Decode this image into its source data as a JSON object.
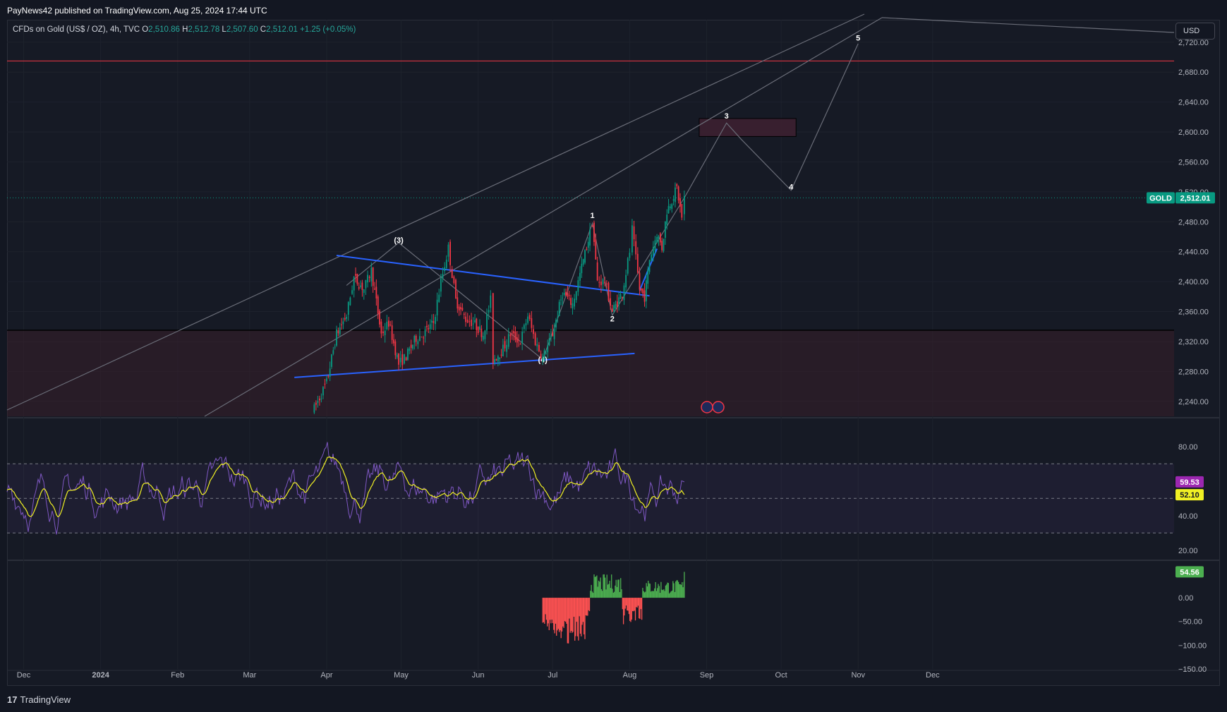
{
  "header": {
    "published": "PayNews42 published on TradingView.com, Aug 25, 2024 17:44 UTC"
  },
  "legend": {
    "symbol": "CFDs on Gold (US$ / OZ), 4h, TVC",
    "o_label": "O",
    "o_value": "2,510.86",
    "h_label": "H",
    "h_value": "2,512.78",
    "l_label": "L",
    "l_value": "2,507.60",
    "c_label": "C",
    "c_value": "2,512.01",
    "change": "+1.25 (+0.05%)"
  },
  "currency_button": "USD",
  "price_tag": {
    "symbol": "GOLD",
    "value": "2,512.01",
    "color": "#089981"
  },
  "rsi_tags": {
    "rsi": "59.53",
    "rsi_color": "#9c27b0",
    "ma": "52.10",
    "ma_color": "#f0f024"
  },
  "osc_tag": {
    "value": "54.56",
    "color": "#4caf50"
  },
  "footer": {
    "logo": "TradingView",
    "logo_mark": "17"
  },
  "colors": {
    "bull": "#089981",
    "bear": "#f23645",
    "trend": "#2962ff",
    "rsi": "#7e57c2",
    "rsi_ma": "#f0f024",
    "hist_pos": "#4caf50",
    "hist_neg": "#ff5252",
    "zone": "#3d1f2a",
    "target_zone": "#3a2030"
  },
  "chart_data": {
    "type": "candlestick",
    "timeframe": "4h",
    "x_ticks": [
      "Dec",
      "2024",
      "Feb",
      "Mar",
      "Apr",
      "May",
      "Jun",
      "Jul",
      "Aug",
      "Sep",
      "Oct",
      "Nov",
      "Dec"
    ],
    "y_ticks": [
      "2,720.00",
      "2,680.00",
      "2,640.00",
      "2,600.00",
      "2,560.00",
      "2,520.00",
      "2,480.00",
      "2,440.00",
      "2,400.00",
      "2,360.00",
      "2,320.00",
      "2,280.00",
      "2,240.00"
    ],
    "ylim": [
      2220,
      2750
    ],
    "price_path": [
      [
        "2024-03-27",
        2230
      ],
      [
        "2024-04-01",
        2265
      ],
      [
        "2024-04-05",
        2330
      ],
      [
        "2024-04-09",
        2355
      ],
      [
        "2024-04-12",
        2405
      ],
      [
        "2024-04-16",
        2390
      ],
      [
        "2024-04-19",
        2415
      ],
      [
        "2024-04-23",
        2330
      ],
      [
        "2024-04-26",
        2345
      ],
      [
        "2024-04-30",
        2290
      ],
      [
        "2024-05-03",
        2300
      ],
      [
        "2024-05-07",
        2325
      ],
      [
        "2024-05-10",
        2330
      ],
      [
        "2024-05-14",
        2345
      ],
      [
        "2024-05-17",
        2400
      ],
      [
        "2024-05-20",
        2445
      ],
      [
        "2024-05-23",
        2375
      ],
      [
        "2024-05-27",
        2350
      ],
      [
        "2024-05-30",
        2345
      ],
      [
        "2024-06-03",
        2330
      ],
      [
        "2024-06-06",
        2375
      ],
      [
        "2024-06-07",
        2295
      ],
      [
        "2024-06-11",
        2310
      ],
      [
        "2024-06-14",
        2330
      ],
      [
        "2024-06-18",
        2320
      ],
      [
        "2024-06-21",
        2355
      ],
      [
        "2024-06-24",
        2320
      ],
      [
        "2024-06-27",
        2298
      ],
      [
        "2024-07-01",
        2330
      ],
      [
        "2024-07-05",
        2385
      ],
      [
        "2024-07-09",
        2370
      ],
      [
        "2024-07-12",
        2410
      ],
      [
        "2024-07-16",
        2465
      ],
      [
        "2024-07-17",
        2480
      ],
      [
        "2024-07-19",
        2400
      ],
      [
        "2024-07-22",
        2400
      ],
      [
        "2024-07-25",
        2360
      ],
      [
        "2024-07-29",
        2385
      ],
      [
        "2024-08-01",
        2440
      ],
      [
        "2024-08-02",
        2470
      ],
      [
        "2024-08-05",
        2390
      ],
      [
        "2024-08-07",
        2380
      ],
      [
        "2024-08-09",
        2430
      ],
      [
        "2024-08-12",
        2465
      ],
      [
        "2024-08-14",
        2445
      ],
      [
        "2024-08-16",
        2495
      ],
      [
        "2024-08-20",
        2525
      ],
      [
        "2024-08-22",
        2485
      ],
      [
        "2024-08-23",
        2512
      ]
    ],
    "current_price": 2512.01,
    "resistance_line": 2695,
    "support_level": 2335,
    "target_zone": [
      2594,
      2618
    ],
    "wave_labels": [
      {
        "label": "(3)",
        "date": "2024-04-30",
        "price": 2452
      },
      {
        "label": "(4)",
        "date": "2024-06-27",
        "price": 2292
      },
      {
        "label": "1",
        "date": "2024-07-17",
        "price": 2485
      },
      {
        "label": "2",
        "date": "2024-07-25",
        "price": 2347
      },
      {
        "label": "3",
        "date": "2024-09-09",
        "price": 2618
      },
      {
        "label": "4",
        "date": "2024-10-05",
        "price": 2523
      },
      {
        "label": "5",
        "date": "2024-11-01",
        "price": 2722
      }
    ],
    "projection": [
      [
        "2024-08-23",
        2512
      ],
      [
        "2024-09-09",
        2612
      ],
      [
        "2024-09-15",
        2590
      ],
      [
        "2024-10-05",
        2522
      ],
      [
        "2024-11-01",
        2718
      ]
    ],
    "rsi_y_ticks": [
      "80.00",
      "40.00",
      "20.00"
    ],
    "rsi_ylim": [
      15,
      95
    ],
    "rsi_value": 59.53,
    "rsi_ma_value": 52.1,
    "osc_y_ticks": [
      "0.00",
      "−50.00",
      "−100.00",
      "−150.00"
    ],
    "osc_ylim": [
      -150,
      70
    ],
    "osc_value": 54.56
  }
}
